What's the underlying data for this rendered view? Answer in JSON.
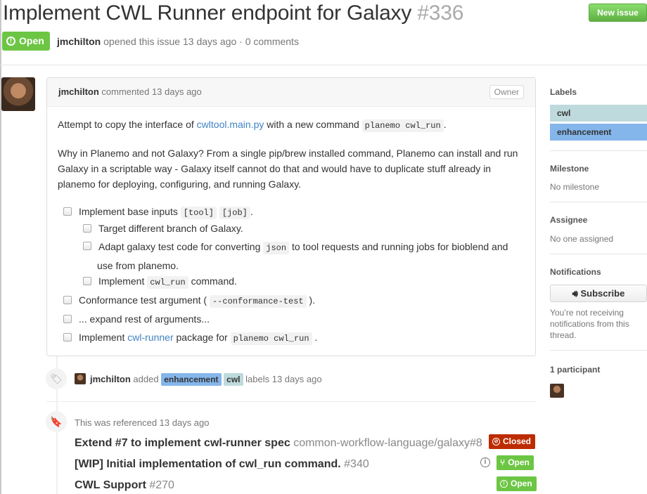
{
  "header": {
    "title": "Implement CWL Runner endpoint for Galaxy",
    "number": "#336",
    "new_issue_label": "New issue",
    "state": "Open",
    "author": "jmchilton",
    "meta_text": "opened this issue 13 days ago · 0 comments"
  },
  "comment": {
    "author": "jmchilton",
    "meta": "commented 13 days ago",
    "role": "Owner",
    "p1_before": "Attempt to copy the interface of",
    "p1_link": "cwltool.main.py",
    "p1_middle": "with a new command",
    "p1_code": "planemo cwl_run",
    "p1_after": ".",
    "p2": "Why in Planemo and not Galaxy? From a single pip/brew installed command, Planemo can install and run Galaxy in a scriptable way - Galaxy itself cannot do that and would have to duplicate stuff already in planemo for deploying, configuring, and running Galaxy.",
    "tasks": {
      "t1_text": "Implement base inputs",
      "t1_code1": "[tool]",
      "t1_code2": "[job]",
      "t1_after": ".",
      "t2_text": "Target different branch of Galaxy.",
      "t3_before": "Adapt galaxy test code for converting",
      "t3_code": "json",
      "t3_after": "to tool requests and running jobs for bioblend and",
      "t3_line2": "use from planemo.",
      "t4_before": "Implement",
      "t4_code": "cwl_run",
      "t4_after": "command.",
      "t5_before": "Conformance test argument (",
      "t5_code": "--conformance-test",
      "t5_after": ").",
      "t6_text": "... expand rest of arguments...",
      "t7_before": "Implement",
      "t7_link": "cwl-runner",
      "t7_middle": "package for",
      "t7_code": "planemo cwl_run",
      "t7_after": "."
    }
  },
  "event": {
    "actor": "jmchilton",
    "action": "added",
    "label1": "enhancement",
    "label2": "cwl",
    "suffix": "labels 13 days ago"
  },
  "references": {
    "note": "This was referenced 13 days ago",
    "items": [
      {
        "title": "Extend #7 to implement cwl-runner spec",
        "sub": "common-workflow-language/galaxy#8",
        "state": "Closed"
      },
      {
        "title": "[WIP] Initial implementation of cwl_run command.",
        "sub": "#340",
        "state": "Open"
      },
      {
        "title": "CWL Support",
        "sub": "#270",
        "state": "Open"
      }
    ]
  },
  "sidebar": {
    "labels_heading": "Labels",
    "label_cwl": "cwl",
    "label_enhancement": "enhancement",
    "milestone_heading": "Milestone",
    "milestone_value": "No milestone",
    "assignee_heading": "Assignee",
    "assignee_value": "No one assigned",
    "notifications_heading": "Notifications",
    "subscribe_label": "Subscribe",
    "notifications_text": "You’re not receiving notifications from this thread.",
    "participants_heading": "1 participant"
  },
  "colors": {
    "open_green": "#6cc644",
    "closed_red": "#bd2c00",
    "label_cwl": "#bfdadc",
    "label_enhancement": "#84b6eb",
    "link": "#4183c4"
  }
}
